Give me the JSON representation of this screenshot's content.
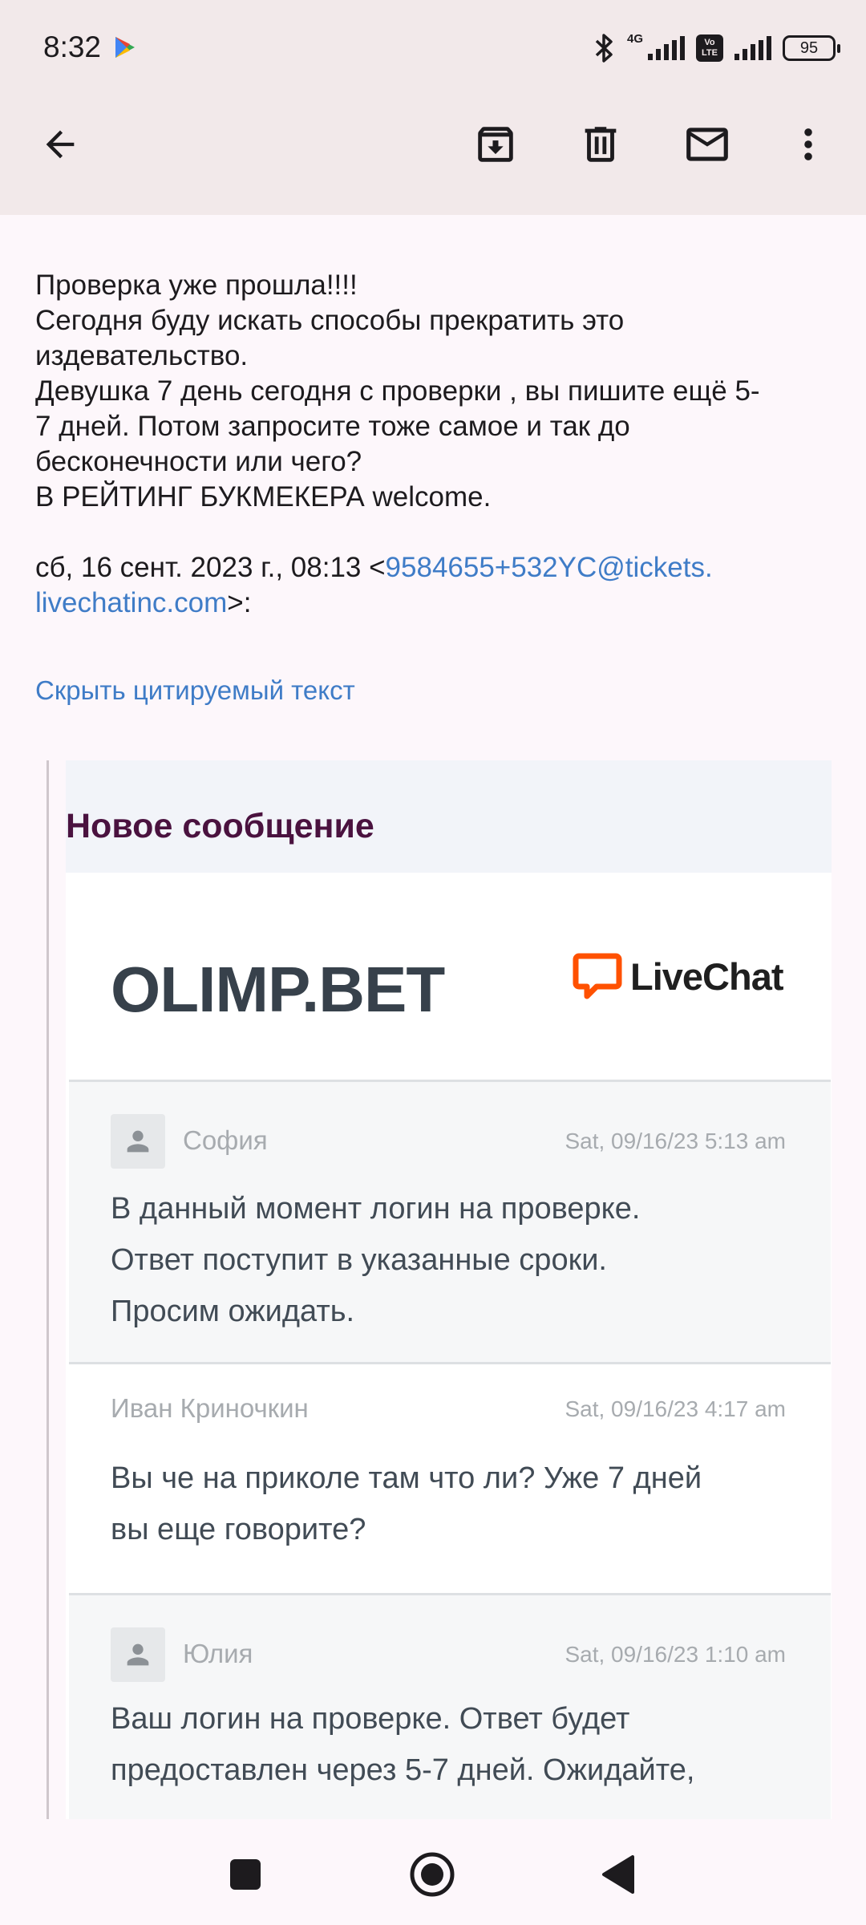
{
  "status_bar": {
    "time": "8:32",
    "network_type": "4G",
    "volte_label": "Vo LTE",
    "battery": "95",
    "icons": [
      "play-store-icon",
      "bluetooth-icon",
      "signal-icon",
      "volte-icon",
      "signal-icon",
      "battery-icon"
    ]
  },
  "toolbar": {
    "icons": [
      "back-arrow-icon",
      "archive-icon",
      "delete-icon",
      "mark-unread-icon",
      "more-vert-icon"
    ]
  },
  "email": {
    "lines": [
      "Проверка уже прошла!!!!",
      "Сегодня буду искать способы прекратить это",
      "издевательство.",
      "Девушка 7 день сегодня с проверки , вы пишите ещё 5-",
      "7 дней. Потом запросите тоже самое и так до",
      "бесконечности или чего?",
      "В РЕЙТИНГ БУКМЕКЕРА welcome."
    ],
    "date_prefix": "сб, 16 сент. 2023 г., 08:13 <",
    "sender_link_line1": "9584655+532YC@tickets.",
    "sender_link_line2": "livechatinc.com",
    "date_suffix": ">:",
    "hide_quote": "Скрыть цитируемый текст"
  },
  "quote": {
    "title": "Новое сообщение",
    "brand": "OLIMP.BET",
    "livechat_label": "LiveChat",
    "messages": [
      {
        "author": "София",
        "time": "Sat, 09/16/23 5:13 am",
        "lines": [
          "В данный момент логин на проверке.",
          "Ответ поступит в указанные сроки.",
          "Просим ожидать."
        ]
      },
      {
        "author": "Иван Криночкин",
        "time": "Sat, 09/16/23 4:17 am",
        "lines": [
          "Вы че на приколе там что ли? Уже 7 дней",
          "вы еще говорите?"
        ]
      },
      {
        "author": "Юлия",
        "time": "Sat, 09/16/23 1:10 am",
        "lines": [
          "Ваш логин на проверке. Ответ будет",
          "предоставлен через 5-7 дней. Ожидайте,"
        ]
      }
    ]
  },
  "nav": {
    "icons": [
      "recents-square-icon",
      "home-circle-icon",
      "back-triangle-icon"
    ]
  }
}
